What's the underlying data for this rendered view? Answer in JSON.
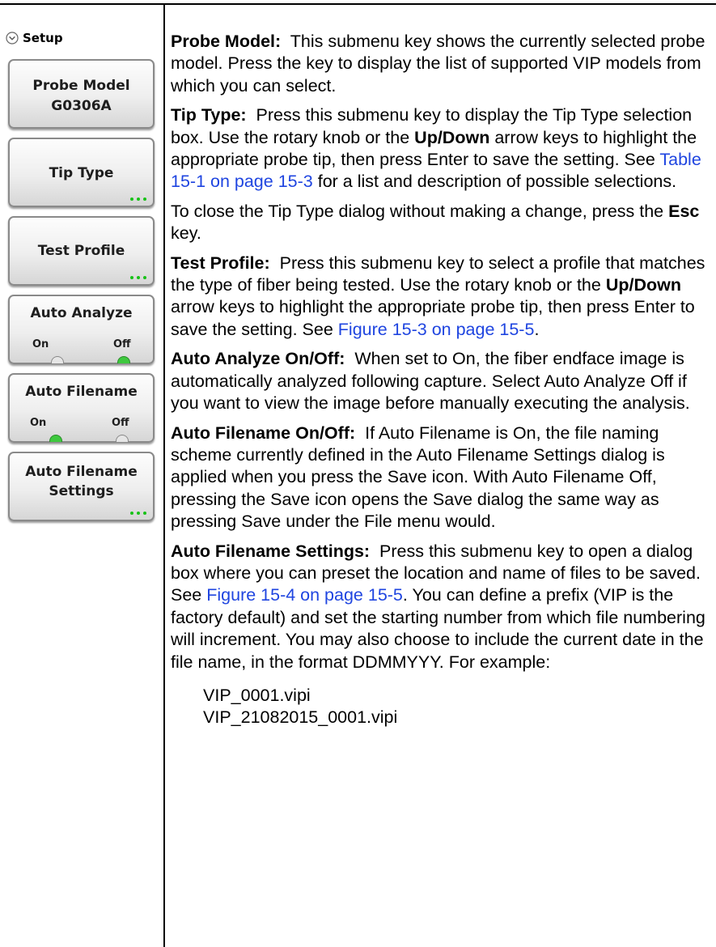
{
  "sidebar": {
    "menu_title": "Setup",
    "probe_model": {
      "label": "Probe Model",
      "value": "G0306A"
    },
    "tip_type": {
      "label": "Tip Type"
    },
    "test_profile": {
      "label": "Test Profile"
    },
    "auto_analyze": {
      "label": "Auto Analyze",
      "on": "On",
      "off": "Off",
      "state": "Off"
    },
    "auto_filename": {
      "label": "Auto Filename",
      "on": "On",
      "off": "Off",
      "state": "On"
    },
    "auto_filename_settings": {
      "label_line1": "Auto Filename",
      "label_line2": "Settings"
    },
    "accent_green": "#2ec42e"
  },
  "content": {
    "probe_model": {
      "term": "Probe Model:",
      "text": "This submenu key shows the currently selected probe model. Press the key to display the list of supported VIP models from which you can select."
    },
    "tip_type": {
      "term": "Tip Type:",
      "text1": "Press this submenu key to display the Tip Type selection box. Use the rotary knob or the",
      "bold1": "Up/Down",
      "text2": "arrow keys to highlight the appropriate probe tip, then press Enter to save the setting. See",
      "link": "Table 15-1 on page 15-3",
      "text3": "for a list and description of possible selections."
    },
    "tip_type_close": {
      "text1": "To close the Tip Type dialog without making a change, press the",
      "bold1": "Esc",
      "text2": "key."
    },
    "test_profile": {
      "term": "Test Profile:",
      "text1": "Press this submenu key to select a profile that matches the type of fiber being tested. Use the rotary knob or the",
      "bold1": "Up/Down",
      "text2": "arrow keys to highlight the appropriate probe tip, then press Enter to save the setting. See",
      "link": "Figure 15-3 on page 15-5",
      "text3": "."
    },
    "auto_analyze": {
      "term": "Auto Analyze On/Off:",
      "text": "When set to On, the fiber endface image is automatically analyzed following capture. Select Auto Analyze Off if you want to view the image before manually executing the analysis."
    },
    "auto_filename": {
      "term": "Auto Filename On/Off:",
      "text": "If Auto Filename is On, the file naming scheme currently defined in the Auto Filename Settings dialog is applied when you press the Save icon. With Auto Filename Off, pressing the Save icon opens the Save dialog the same way as pressing Save under the File menu would."
    },
    "auto_filename_settings": {
      "term": "Auto Filename Settings:",
      "text1": "Press this submenu key to open a dialog box where you can preset the location and name of files to be saved. See",
      "link": "Figure 15-4 on page 15-5",
      "text2": ". You can define a prefix (VIP is the factory default) and set the starting number from which file numbering will increment. You may also choose to include the current date in the file name, in the format DDMMYYY. For example:"
    },
    "examples": [
      "VIP_0001.vipi",
      "VIP_21082015_0001.vipi"
    ],
    "link_color": "#1f45e0"
  }
}
